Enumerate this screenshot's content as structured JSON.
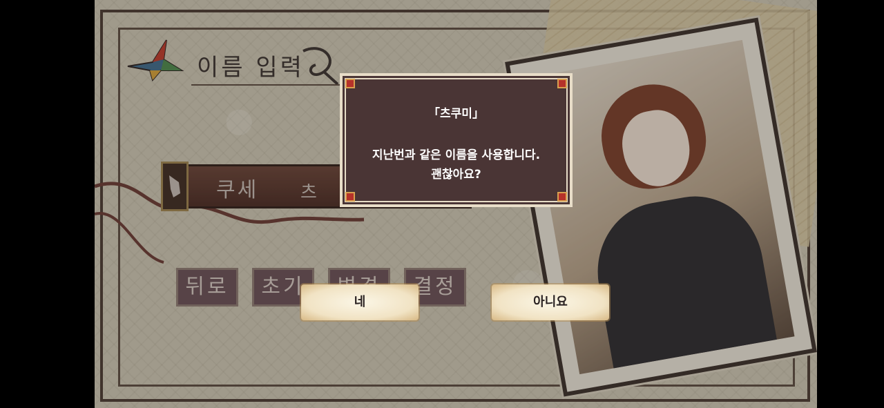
{
  "header": {
    "title": "이름 입력"
  },
  "name_entry": {
    "surname": "쿠세",
    "given_name_partial": "츠 쿠"
  },
  "keys": {
    "back": "뒤로",
    "reset": "초기",
    "change": "변경",
    "confirm": "결정"
  },
  "dialog": {
    "name": "「츠쿠미」",
    "line1": "지난번과 같은 이름을 사용합니다.",
    "line2": "괜찮아요?"
  },
  "choices": {
    "yes": "네",
    "no": "아니요"
  },
  "colors": {
    "dialog_bg": "#4a3535",
    "dialog_border": "#e8ddc8",
    "corner_accent": "#b6322a",
    "choice_bg": "#f1e3c4"
  }
}
